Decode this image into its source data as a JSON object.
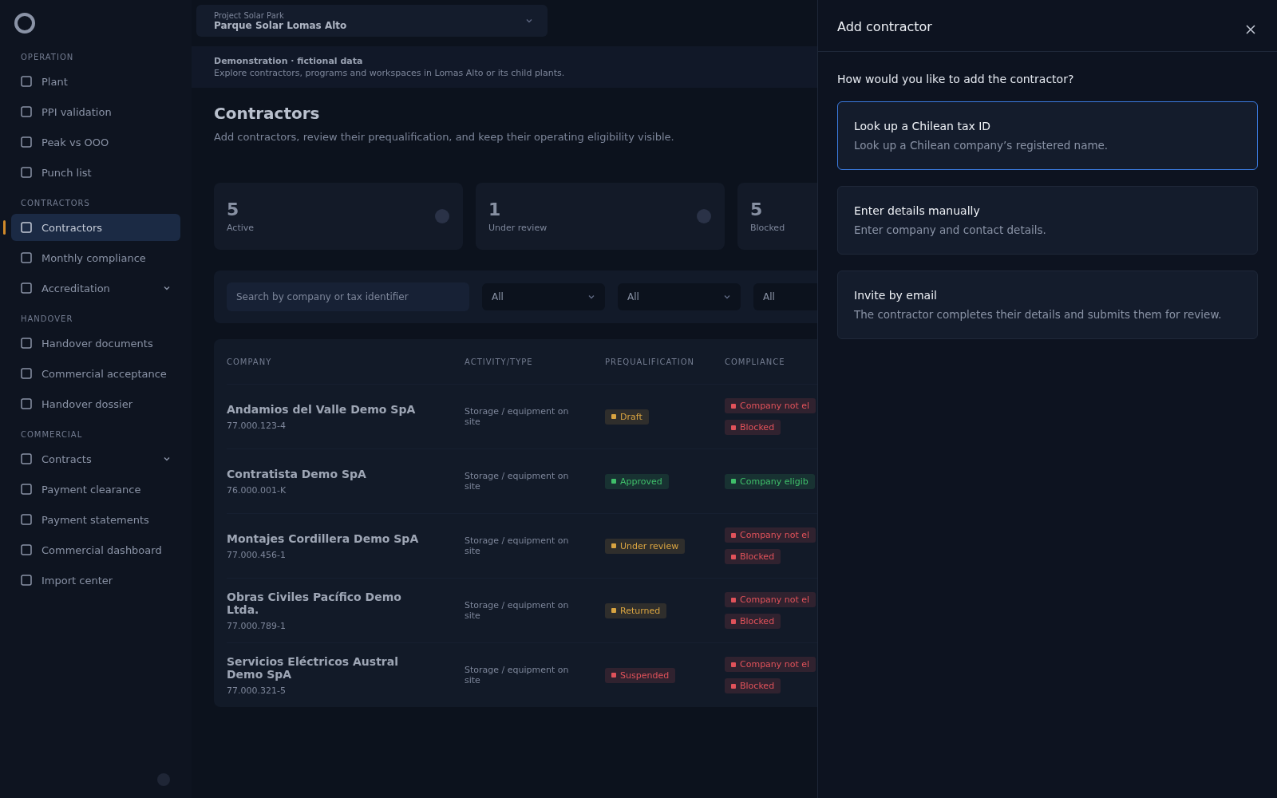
{
  "sidebar": {
    "sections": [
      {
        "title": "OPERATION",
        "items": [
          {
            "label": "Plant",
            "selected": false,
            "expandable": false
          },
          {
            "label": "PPI validation",
            "selected": false,
            "expandable": false
          },
          {
            "label": "Peak vs OOO",
            "selected": false,
            "expandable": false
          },
          {
            "label": "Punch list",
            "selected": false,
            "expandable": false
          }
        ]
      },
      {
        "title": "CONTRACTORS",
        "items": [
          {
            "label": "Contractors",
            "selected": true,
            "expandable": false
          },
          {
            "label": "Monthly compliance",
            "selected": false,
            "expandable": false
          },
          {
            "label": "Accreditation",
            "selected": false,
            "expandable": true
          }
        ]
      },
      {
        "title": "HANDOVER",
        "items": [
          {
            "label": "Handover documents",
            "selected": false,
            "expandable": false
          },
          {
            "label": "Commercial acceptance",
            "selected": false,
            "expandable": false
          },
          {
            "label": "Handover dossier",
            "selected": false,
            "expandable": false
          }
        ]
      },
      {
        "title": "COMMERCIAL",
        "items": [
          {
            "label": "Contracts",
            "selected": false,
            "expandable": true
          },
          {
            "label": "Payment clearance",
            "selected": false,
            "expandable": false
          },
          {
            "label": "Payment statements",
            "selected": false,
            "expandable": false
          },
          {
            "label": "Commercial dashboard",
            "selected": false,
            "expandable": false
          },
          {
            "label": "Import center",
            "selected": false,
            "expandable": false
          }
        ]
      }
    ]
  },
  "project_switcher": {
    "caption": "Project Solar Park",
    "value": "Parque Solar Lomas Alto"
  },
  "banner": {
    "title": "Demonstration · fictional data",
    "text": "Explore contractors, programs and workspaces in Lomas Alto or its child plants."
  },
  "page": {
    "title": "Contractors",
    "subtitle": "Add contractors, review their prequalification, and keep their operating eligibility visible."
  },
  "stats": [
    {
      "value": "5",
      "label": "Active"
    },
    {
      "value": "1",
      "label": "Under review"
    },
    {
      "value": "5",
      "label": "Blocked"
    }
  ],
  "filters": {
    "search_placeholder": "Search by company or tax identifier",
    "selects": [
      "All",
      "All",
      "All"
    ]
  },
  "table": {
    "columns": [
      "COMPANY",
      "ACTIVITY/TYPE",
      "PREQUALIFICATION",
      "COMPLIANCE"
    ],
    "rows": [
      {
        "company": "Andamios del Valle Demo SpA",
        "tax_id": "77.000.123-4",
        "activity": "Storage / equipment on site",
        "prequalification": {
          "label": "Draft",
          "color": "#d9a441"
        },
        "compliance": [
          {
            "label": "Company not el",
            "color": "#e0525a"
          },
          {
            "label": "Blocked",
            "color": "#e0525a"
          }
        ]
      },
      {
        "company": "Contratista Demo SpA",
        "tax_id": "76.000.001-K",
        "activity": "Storage / equipment on site",
        "prequalification": {
          "label": "Approved",
          "color": "#3fbf6a"
        },
        "compliance": [
          {
            "label": "Company eligib",
            "color": "#3fbf6a"
          }
        ]
      },
      {
        "company": "Montajes Cordillera Demo SpA",
        "tax_id": "77.000.456-1",
        "activity": "Storage / equipment on site",
        "prequalification": {
          "label": "Under review",
          "color": "#d9a441"
        },
        "compliance": [
          {
            "label": "Company not el",
            "color": "#e0525a"
          },
          {
            "label": "Blocked",
            "color": "#e0525a"
          }
        ]
      },
      {
        "company": "Obras Civiles Pacífico Demo Ltda.",
        "tax_id": "77.000.789-1",
        "activity": "Storage / equipment on site",
        "prequalification": {
          "label": "Returned",
          "color": "#d9a441"
        },
        "compliance": [
          {
            "label": "Company not el",
            "color": "#e0525a"
          },
          {
            "label": "Blocked",
            "color": "#e0525a"
          }
        ]
      },
      {
        "company": "Servicios Eléctricos Austral Demo SpA",
        "tax_id": "77.000.321-5",
        "activity": "Storage / equipment on site",
        "prequalification": {
          "label": "Suspended",
          "color": "#e0525a"
        },
        "compliance": [
          {
            "label": "Company not el",
            "color": "#e0525a"
          },
          {
            "label": "Blocked",
            "color": "#e0525a"
          }
        ]
      }
    ]
  },
  "panel": {
    "title": "Add contractor",
    "question": "How would you like to add the contractor?",
    "options": [
      {
        "title": "Look up a Chilean tax ID",
        "description": "Look up a Chilean company’s registered name.",
        "selected": true
      },
      {
        "title": "Enter details manually",
        "description": "Enter company and contact details.",
        "selected": false
      },
      {
        "title": "Invite by email",
        "description": "The contractor completes their details and submits them for review.",
        "selected": false
      }
    ]
  }
}
